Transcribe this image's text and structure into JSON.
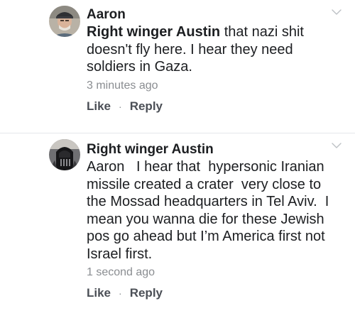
{
  "comments": [
    {
      "avatar_icon": "avatar-older-man-photo",
      "author": "Aaron",
      "mention": "Right winger Austin",
      "text": " that nazi shit doesn't fly here. I hear they need soldiers in Gaza.",
      "timestamp": "3 minutes ago",
      "like_label": "Like",
      "separator": "·",
      "reply_label": "Reply"
    },
    {
      "avatar_icon": "avatar-dark-helmet-photo",
      "author": "Right winger Austin",
      "mention": "",
      "text": "Aaron   I hear that  hypersonic Iranian missile created a crater  very close to the Mossad headquarters in Tel Aviv.  I mean you wanna die for these Jewish pos go ahead but I’m America first not Israel first.",
      "timestamp": "1 second ago",
      "like_label": "Like",
      "separator": "·",
      "reply_label": "Reply"
    }
  ]
}
